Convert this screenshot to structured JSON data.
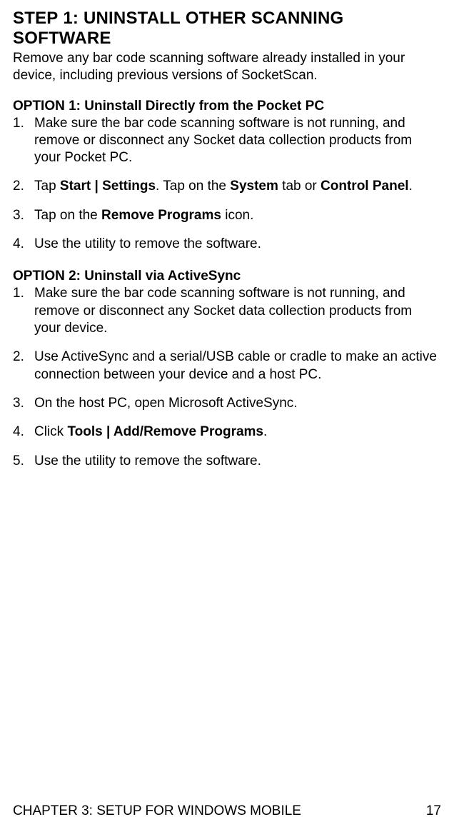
{
  "heading": {
    "prefix": "S",
    "step": "TEP",
    "num": " 1: U",
    "w1": "NINSTALL",
    "o": " O",
    "w2": "THER",
    "s": " S",
    "w3": "CANNING",
    "s2": " S",
    "w4": "OFTWARE"
  },
  "intro": "Remove any bar code scanning software already installed in your device, including previous versions of SocketScan.",
  "option1": {
    "title": "OPTION 1: Uninstall Directly from the Pocket PC",
    "items": {
      "i1": "Make sure the bar code scanning software is not running, and remove or disconnect any Socket data collection products from your Pocket PC.",
      "i2a": "Tap ",
      "i2b": "Start | Settings",
      "i2c": ". Tap on the ",
      "i2d": "System",
      "i2e": " tab or ",
      "i2f": "Control Panel",
      "i2g": ".",
      "i3a": "Tap on the ",
      "i3b": "Remove Programs",
      "i3c": " icon.",
      "i4": "Use the utility to remove the software."
    }
  },
  "option2": {
    "title": "OPTION 2: Uninstall via ActiveSync",
    "items": {
      "i1": "Make sure the bar code scanning software is not running, and remove or disconnect any Socket data collection products from your device.",
      "i2": "Use ActiveSync and a serial/USB cable or cradle to make an active connection between your device and a host PC.",
      "i3": "On the host PC, open Microsoft ActiveSync.",
      "i4a": "Click ",
      "i4b": "Tools | Add/Remove Programs",
      "i4c": ".",
      "i5": "Use the utility to remove the software."
    }
  },
  "footer": {
    "chapter": "CHAPTER 3: SETUP FOR WINDOWS MOBILE",
    "page": "17"
  }
}
